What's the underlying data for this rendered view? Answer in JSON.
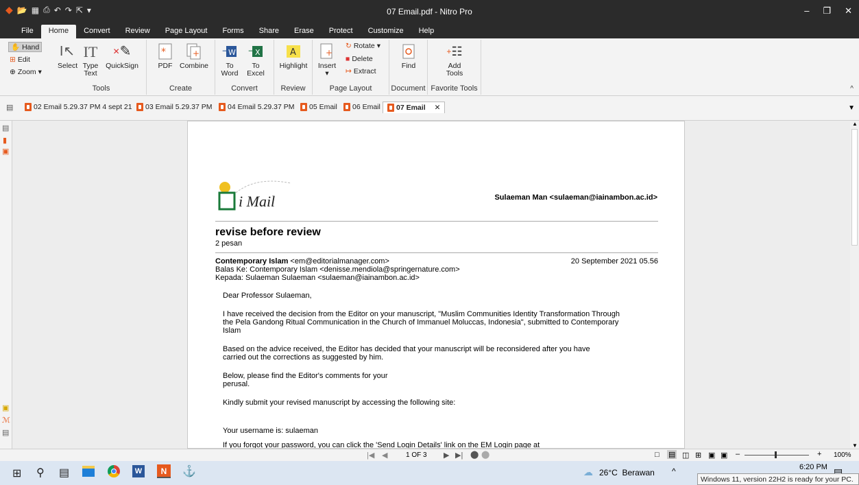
{
  "window": {
    "title": "07 Email.pdf - Nitro Pro"
  },
  "menu": [
    "File",
    "Home",
    "Convert",
    "Review",
    "Page Layout",
    "Forms",
    "Share",
    "Erase",
    "Protect",
    "Customize",
    "Help"
  ],
  "ribbon": {
    "hand": "Hand",
    "edit": "Edit",
    "zoom": "Zoom",
    "select": "Select",
    "type_text_1": "Type",
    "type_text_2": "Text",
    "quicksign": "QuickSign",
    "tools_group": "Tools",
    "pdf": "PDF",
    "combine": "Combine",
    "create_group": "Create",
    "to_word_1": "To",
    "to_word_2": "Word",
    "to_excel_1": "To",
    "to_excel_2": "Excel",
    "convert_group": "Convert",
    "highlight": "Highlight",
    "review_group": "Review",
    "insert": "Insert",
    "rotate": "Rotate",
    "delete": "Delete",
    "extract": "Extract",
    "page_layout_group": "Page Layout",
    "find": "Find",
    "document_group": "Document",
    "add_tools_1": "Add",
    "add_tools_2": "Tools",
    "favorite_tools_group": "Favorite Tools"
  },
  "tabs": [
    "02 Email 5.29.37 PM 4 sept 21",
    "03 Email 5.29.37 PM",
    "04 Email 5.29.37 PM",
    "05 Email",
    "06 Email",
    "07 Email"
  ],
  "email": {
    "logo_text": "i Mail",
    "account": "Sulaeman Man <sulaeman@iainambon.ac.id>",
    "subject": "revise before review",
    "count": "2 pesan",
    "from_name": "Contemporary Islam",
    "from_addr": " <em@editorialmanager.com>",
    "date": "20 September 2021 05.56",
    "reply_to": "Balas Ke: Contemporary Islam <denisse.mendiola@springernature.com>",
    "to": "Kepada: Sulaeman Sulaeman <sulaeman@iainambon.ac.id>",
    "greeting": "Dear Professor Sulaeman,",
    "p1_l1": "I have received the decision from the Editor on your manuscript, \"Muslim Communities Identity Transformation Through",
    "p1_l2": "the Pela Gandong Ritual Communication in the Church of Immanuel Moluccas, Indonesia\", submitted to Contemporary",
    "p1_l3": "Islam",
    "p2_l1": "Based on the advice received, the Editor has decided that your manuscript will be reconsidered after you have",
    "p2_l2": "carried out the corrections as suggested by him.",
    "p3_l1": "Below, please find the Editor's comments for your",
    "p3_l2": "perusal.",
    "p4": "Kindly submit your revised manuscript by accessing the following site:",
    "p5": "Your username is: sulaeman",
    "p6": "If you forgot your password, you can click the 'Send Login Details' link on the EM Login page at"
  },
  "status": {
    "page": "1 OF 3",
    "zoom": "100%"
  },
  "taskbar": {
    "weather": "26°C  Berawan",
    "time": "6:20 PM",
    "toast": "Windows 11, version 22H2 is ready for your PC."
  },
  "colors": {
    "titlebar": "#2b2b2b",
    "ribbon": "#f3f3f3",
    "accent": "#e65a1e",
    "taskbar": "#dce6f2"
  }
}
